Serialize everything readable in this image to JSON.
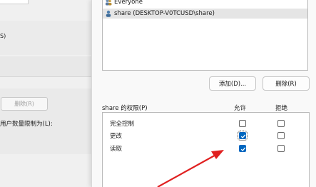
{
  "background_dialog": {
    "partial_text": "S)",
    "remove_button": "删除(R)",
    "limit_label": "用户数量限制为(L):"
  },
  "users": [
    {
      "name": "Everyone",
      "icon": "group-icon"
    },
    {
      "name": "share (DESKTOP-V0TCUSD\\share)",
      "icon": "user-icon"
    }
  ],
  "buttons": {
    "add": "添加(D)...",
    "delete": "删除(R)"
  },
  "permissions": {
    "title": "share 的权限(P)",
    "allow_header": "允许",
    "deny_header": "拒绝",
    "rows": [
      {
        "label": "完全控制",
        "allow": false,
        "deny": false
      },
      {
        "label": "更改",
        "allow": true,
        "deny": false
      },
      {
        "label": "读取",
        "allow": true,
        "deny": false
      }
    ]
  },
  "colors": {
    "accent": "#0067c0",
    "arrow": "#e02020"
  }
}
